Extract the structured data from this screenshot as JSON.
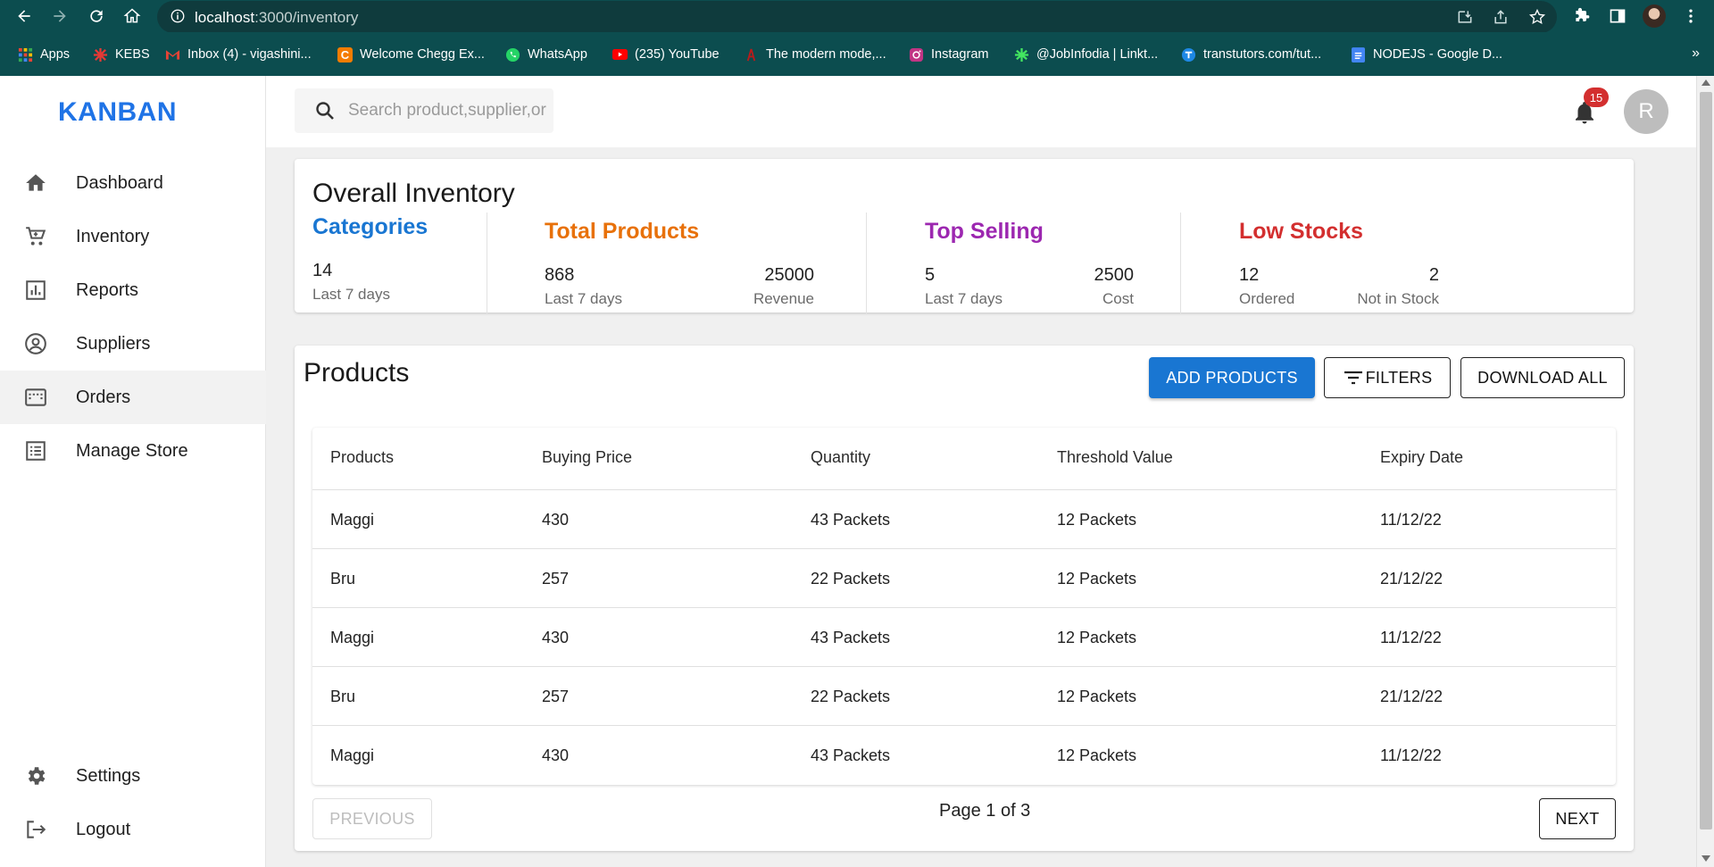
{
  "browser": {
    "url_host": "localhost",
    "url_path": ":3000/inventory",
    "bookmarks": [
      {
        "label": "Apps",
        "icon": "apps-grid-icon",
        "color": "#ea4335"
      },
      {
        "label": "KEBS",
        "icon": "kebs-icon",
        "color": "#e53935"
      },
      {
        "label": "Inbox (4) - vigashini...",
        "icon": "gmail-icon",
        "color": "#ea4335"
      },
      {
        "label": "Welcome Chegg Ex...",
        "icon": "chegg-icon",
        "color": "#f57c00"
      },
      {
        "label": "WhatsApp",
        "icon": "whatsapp-icon",
        "color": "#25d366"
      },
      {
        "label": "(235) YouTube",
        "icon": "youtube-icon",
        "color": "#ff0000"
      },
      {
        "label": "The modern mode,...",
        "icon": "bookmark-red-icon",
        "color": "#b71c1c"
      },
      {
        "label": "Instagram",
        "icon": "instagram-icon",
        "color": "#c13584"
      },
      {
        "label": "@JobInfodia | Linkt...",
        "icon": "linktree-icon",
        "color": "#43e660"
      },
      {
        "label": "transtutors.com/tut...",
        "icon": "transtutors-icon",
        "color": "#1e88e5"
      },
      {
        "label": "NODEJS - Google D...",
        "icon": "google-docs-icon",
        "color": "#4285f4"
      }
    ],
    "bookmarks_more": "»"
  },
  "brand": "KANBAN",
  "sidebar": {
    "items": [
      {
        "label": "Dashboard",
        "icon": "home-icon"
      },
      {
        "label": "Inventory",
        "icon": "cart-icon"
      },
      {
        "label": "Reports",
        "icon": "reports-icon"
      },
      {
        "label": "Suppliers",
        "icon": "account-circle-icon"
      },
      {
        "label": "Orders",
        "icon": "orders-icon"
      },
      {
        "label": "Manage Store",
        "icon": "list-icon"
      }
    ],
    "bottom": [
      {
        "label": "Settings",
        "icon": "gear-icon"
      },
      {
        "label": "Logout",
        "icon": "logout-icon"
      }
    ]
  },
  "topbar": {
    "search_placeholder": "Search product,supplier,order",
    "notification_count": "15",
    "avatar_initial": "R"
  },
  "overall": {
    "title": "Overall Inventory",
    "categories": {
      "heading": "Categories",
      "value": "14",
      "sub": "Last 7 days",
      "color": "#1976d2"
    },
    "total_products": {
      "heading": "Total Products",
      "value": "868",
      "sub": "Last 7 days",
      "value2": "25000",
      "sub2": "Revenue",
      "color": "#e8710a"
    },
    "top_selling": {
      "heading": "Top Selling",
      "value": "5",
      "sub": "Last 7 days",
      "value2": "2500",
      "sub2": "Cost",
      "color": "#9c27b0"
    },
    "low_stocks": {
      "heading": "Low Stocks",
      "value": "12",
      "sub": "Ordered",
      "value2": "2",
      "sub2": "Not in Stock",
      "color": "#d32f2f"
    }
  },
  "products": {
    "title": "Products",
    "add_label": "ADD PRODUCTS",
    "filters_label": "FILTERS",
    "download_label": "DOWNLOAD ALL",
    "columns": [
      "Products",
      "Buying Price",
      "Quantity",
      "Threshold Value",
      "Expiry Date"
    ],
    "rows": [
      [
        "Maggi",
        "430",
        "43 Packets",
        "12 Packets",
        "11/12/22"
      ],
      [
        "Bru",
        "257",
        "22 Packets",
        "12 Packets",
        "21/12/22"
      ],
      [
        "Maggi",
        "430",
        "43 Packets",
        "12 Packets",
        "11/12/22"
      ],
      [
        "Bru",
        "257",
        "22 Packets",
        "12 Packets",
        "21/12/22"
      ],
      [
        "Maggi",
        "430",
        "43 Packets",
        "12 Packets",
        "11/12/22"
      ]
    ],
    "previous_label": "PREVIOUS",
    "next_label": "NEXT",
    "page_info": "Page 1 of 3"
  }
}
